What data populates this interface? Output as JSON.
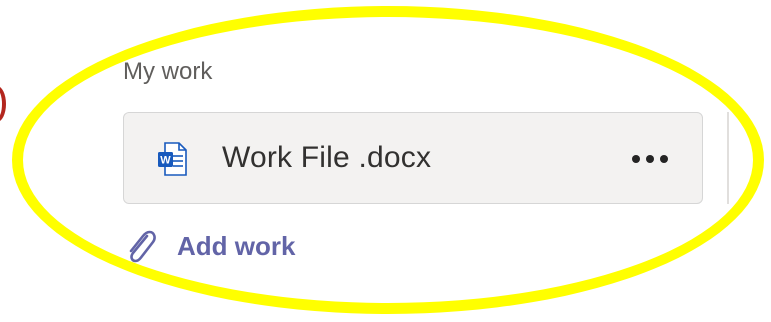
{
  "section": {
    "title": "My work"
  },
  "file": {
    "name": "Work File .docx",
    "icon": "word-document-icon",
    "more_icon": "more-options-icon"
  },
  "add_work": {
    "label": "Add work",
    "icon": "paperclip-icon"
  },
  "colors": {
    "accent": "#6264a7",
    "highlight": "#ffff00",
    "card_background": "#f3f2f1",
    "word_blue": "#185abd"
  }
}
